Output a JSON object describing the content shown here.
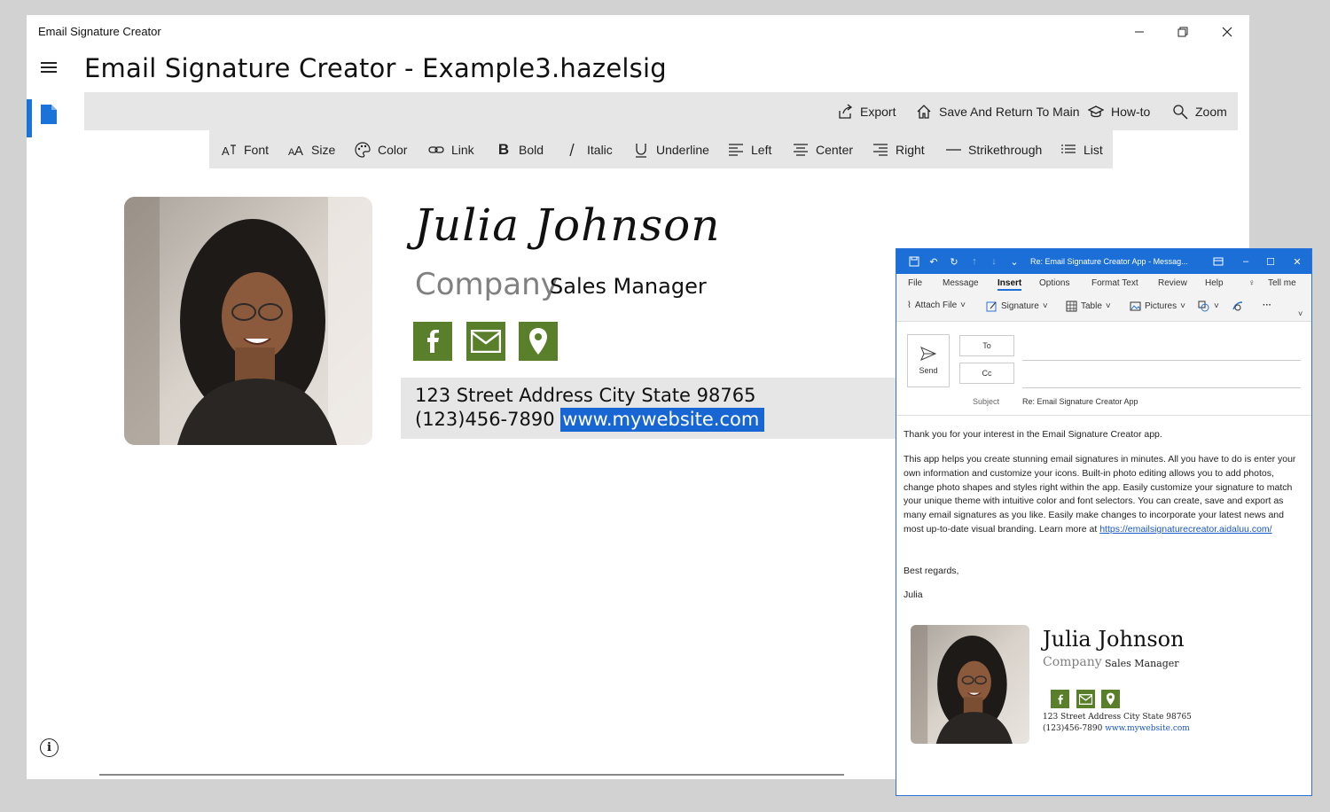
{
  "window": {
    "title": "Email Signature Creator",
    "app_heading": "Email Signature Creator - Example3.hazelsig"
  },
  "commands": [
    {
      "label": "Export",
      "icon": "export-icon"
    },
    {
      "label": "Save And Return To Main",
      "icon": "home-icon"
    },
    {
      "label": "How-to",
      "icon": "graduation-cap-icon"
    },
    {
      "label": "Zoom",
      "icon": "magnifier-icon"
    }
  ],
  "format_toolbar": [
    {
      "label": "Font",
      "icon": "font-icon"
    },
    {
      "label": "Size",
      "icon": "font-size-icon"
    },
    {
      "label": "Color",
      "icon": "palette-icon"
    },
    {
      "label": "Link",
      "icon": "link-icon"
    },
    {
      "label": "Bold",
      "icon": "bold-icon"
    },
    {
      "label": "Italic",
      "icon": "italic-icon"
    },
    {
      "label": "Underline",
      "icon": "underline-icon"
    },
    {
      "label": "Left",
      "icon": "align-left-icon"
    },
    {
      "label": "Center",
      "icon": "align-center-icon"
    },
    {
      "label": "Right",
      "icon": "align-right-icon"
    },
    {
      "label": "Strikethrough",
      "icon": "strikethrough-icon"
    },
    {
      "label": "List",
      "icon": "list-icon"
    }
  ],
  "signature": {
    "name": "Julia Johnson",
    "company": "Company",
    "role": "Sales Manager",
    "address": "123 Street Address City State 98765",
    "phone": "(123)456-7890",
    "website": "www.mywebsite.com",
    "social_icons": [
      "facebook-icon",
      "email-icon",
      "location-pin-icon"
    ],
    "accent_color": "#5a7f2a"
  },
  "outlook": {
    "title": "Re: Email Signature Creator App  -  Messag...",
    "tabs": [
      "File",
      "Message",
      "Insert",
      "Options",
      "Format Text",
      "Review",
      "Help",
      "Tell me"
    ],
    "active_tab": "Insert",
    "ribbon": {
      "attach": "Attach File",
      "signature": "Signature",
      "table": "Table",
      "pictures": "Pictures"
    },
    "send": "Send",
    "to": "To",
    "cc": "Cc",
    "subject_label": "Subject",
    "subject": "Re: Email Signature Creator App",
    "body_line1": "Thank you for your interest in the Email Signature Creator app.",
    "body_para": "This app helps you create stunning email signatures in minutes.  All you have to do is enter your own information and customize your icons.  Built-in photo editing allows you to add photos, change photo shapes and styles right within the app.  Easily customize your signature to match your unique theme with intuitive color and font selectors.  You can create, save and export as many email signatures as you like.  Easily make changes to incorporate your latest news and most up-to-date visual branding.  Learn more at",
    "body_link": "https://emailsignaturecreator.aidaluu.com/",
    "closing": "Best regards,",
    "signoff": "Julia",
    "accent_color": "#1b6fd6"
  }
}
